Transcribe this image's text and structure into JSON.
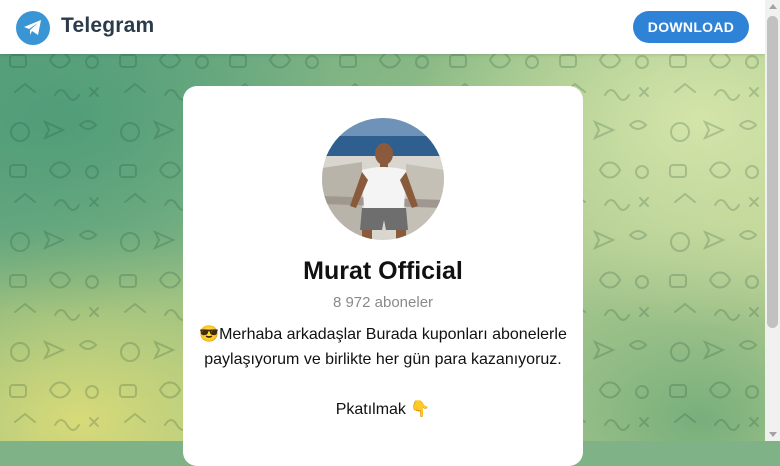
{
  "header": {
    "brand": "Telegram",
    "download_label": "DOWNLOAD"
  },
  "channel": {
    "name": "Murat Official",
    "subscribers": "8 972 aboneler",
    "description_line1": "😎Merhaba arkadaşlar Burada kuponları abonelerle",
    "description_line2": "paylaşıyorum ve birlikte her gün para kazanıyoruz.",
    "description_line3": "Pkatılmak 👇"
  },
  "colors": {
    "accent": "#2f83d6",
    "logo": "#3a95d4"
  },
  "icons": {
    "logo": "telegram-paper-plane-icon"
  }
}
